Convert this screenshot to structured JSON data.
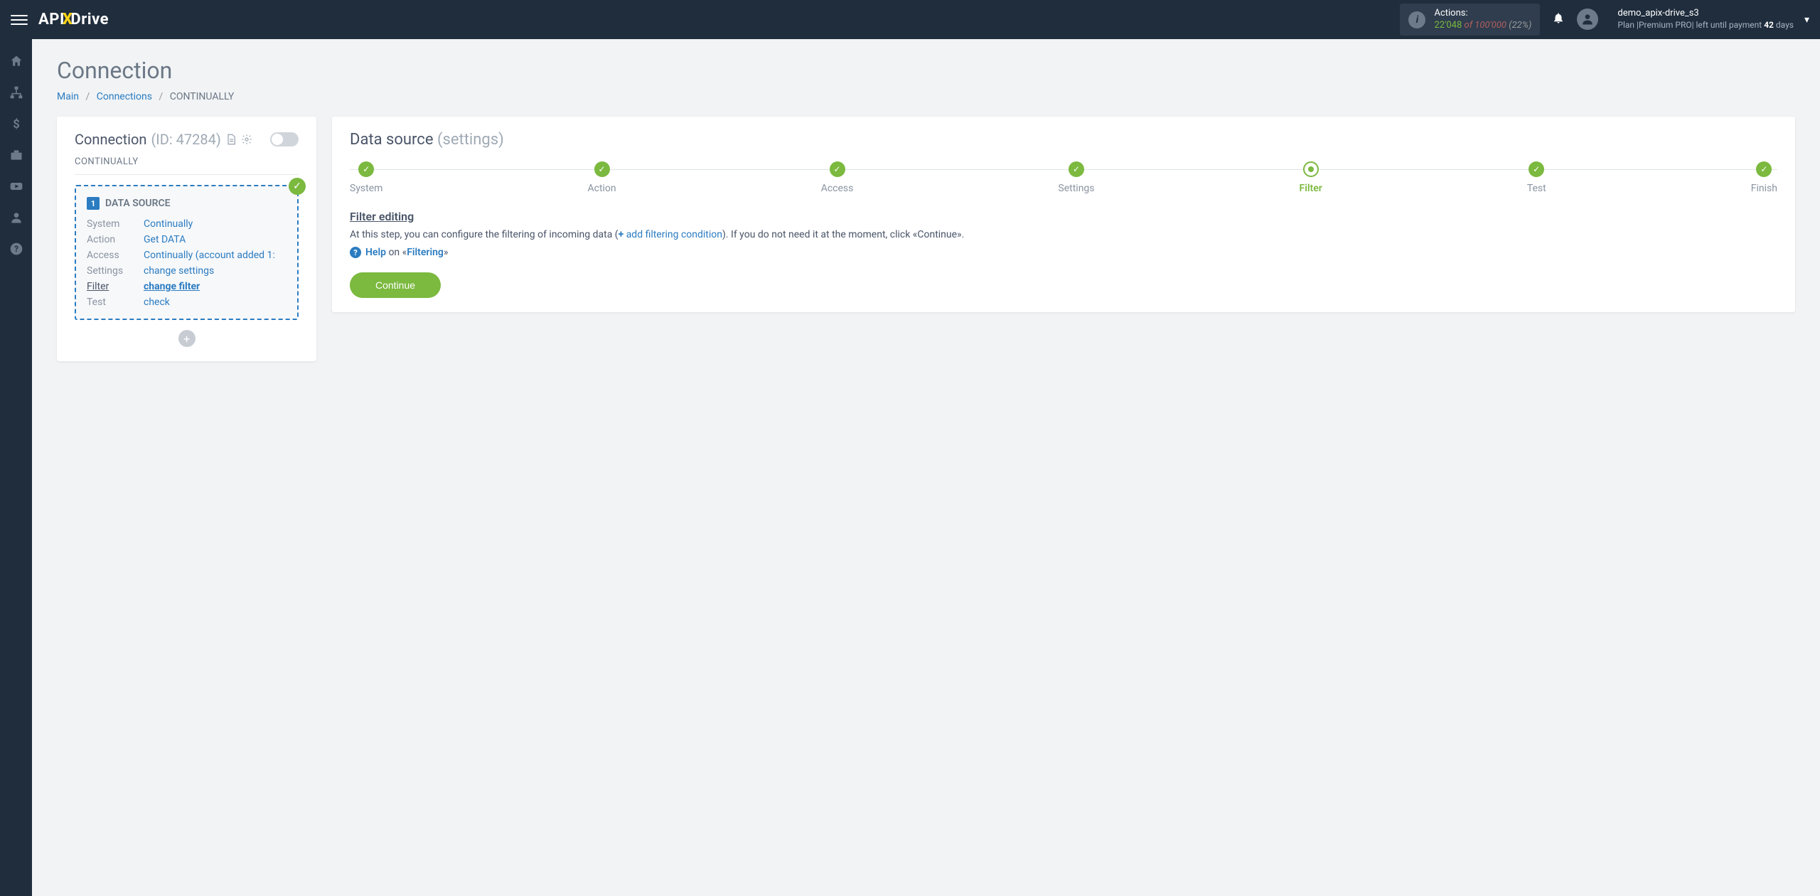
{
  "header": {
    "logo_pre": "API",
    "logo_x": "X",
    "logo_post": "Drive",
    "actions_label": "Actions:",
    "actions_used": "22'048",
    "actions_of": "of",
    "actions_total": "100'000",
    "actions_pct": "(22%)",
    "user_name": "demo_apix-drive_s3",
    "plan_prefix": "Plan  |",
    "plan_name": "Premium PRO",
    "plan_mid": "|  left until payment ",
    "plan_days": "42",
    "plan_suffix": " days"
  },
  "page": {
    "title": "Connection",
    "crumb_main": "Main",
    "crumb_connections": "Connections",
    "crumb_current": "CONTINUALLY"
  },
  "left": {
    "title": "Connection",
    "id_label": "(ID: 47284)",
    "name": "CONTINUALLY",
    "ds_badge": "1",
    "ds_title": "DATA SOURCE",
    "rows": {
      "system": {
        "label": "System",
        "value": "Continually"
      },
      "action": {
        "label": "Action",
        "value": "Get DATA"
      },
      "access": {
        "label": "Access",
        "value": "Continually (account added 1:"
      },
      "settings": {
        "label": "Settings",
        "value": "change settings"
      },
      "filter": {
        "label": "Filter",
        "value": "change filter"
      },
      "test": {
        "label": "Test",
        "value": "check"
      }
    }
  },
  "right": {
    "title": "Data source",
    "subtitle": "(settings)",
    "steps": [
      "System",
      "Action",
      "Access",
      "Settings",
      "Filter",
      "Test",
      "Finish"
    ],
    "filter_heading": "Filter editing",
    "filter_text_a": "At this step, you can configure the filtering of incoming data (",
    "filter_add": "add filtering condition",
    "filter_text_b": "). If you do not need it at the moment, click «Continue».",
    "help_a": "Help",
    "help_b": " on «",
    "help_c": "Filtering",
    "help_d": "»",
    "continue": "Continue"
  }
}
